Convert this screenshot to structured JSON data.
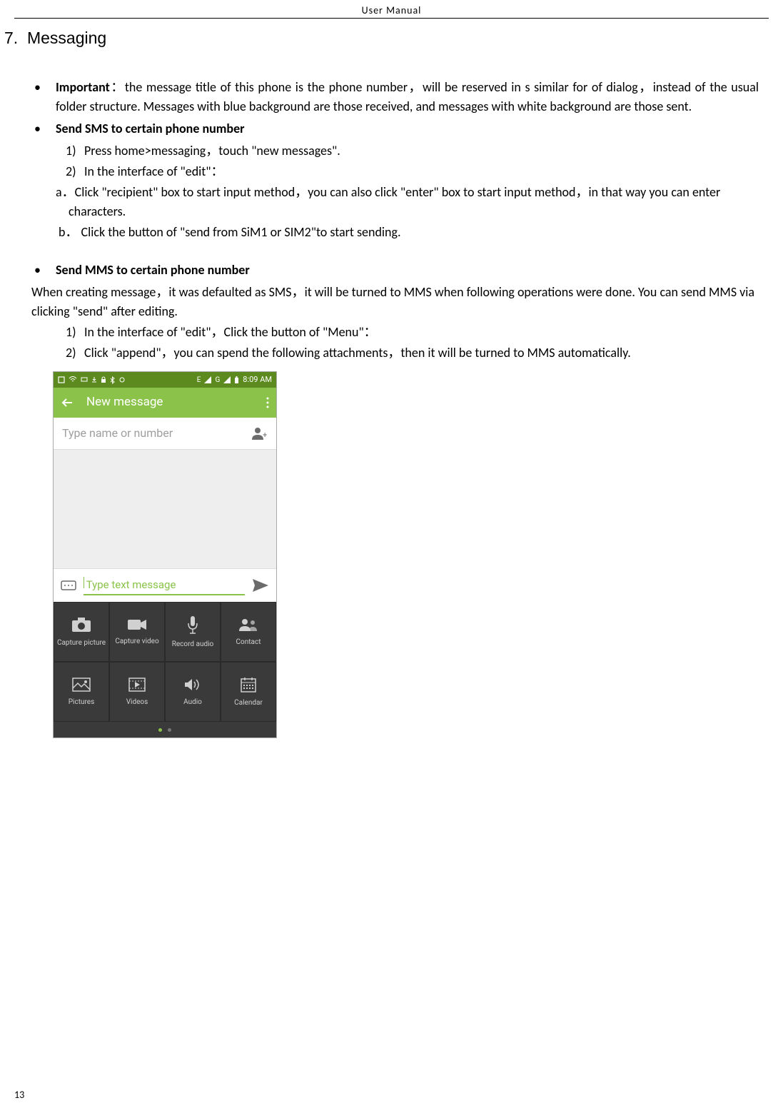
{
  "header": "User    Manual",
  "section": {
    "number": "7.",
    "title": "Messaging"
  },
  "bullets": {
    "important": {
      "label": "Important",
      "text": "：the message title of this phone is the phone number，will be reserved in s similar for of dialog，instead of the usual folder structure. Messages with blue background are those received, and messages with white background are those sent."
    },
    "sms": {
      "label": "Send SMS to certain phone number",
      "steps": [
        {
          "num": "1)",
          "text": "Press home>messaging，touch \"new messages\"."
        },
        {
          "num": "2)",
          "text": "In the interface of \"edit\"："
        }
      ],
      "sub_a": "a．Click \"recipient\" box to start input method，you can also click \"enter\" box to start input method，in that way you can enter characters.",
      "sub_b": "b． Click the button of \"send from SiM1 or SIM2\"to start sending."
    },
    "mms": {
      "label": "Send MMS to certain phone number",
      "para": "When creating message，it was defaulted as SMS，it will be turned to MMS when following operations were done. You can send MMS via clicking \"send\" after editing.",
      "steps": [
        {
          "num": "1)",
          "text": "In the interface of \"edit\"，Click the button of \"Menu\"："
        },
        {
          "num": "2)",
          "text": "Click \"append\"，you can spend the following attachments，then it will be turned to MMS automatically."
        }
      ]
    }
  },
  "phone": {
    "time": "8:09 AM",
    "signal_labels": [
      "E",
      "G"
    ],
    "appbar_title": "New message",
    "recipient_placeholder": "Type name or number",
    "compose_placeholder": "Type text message",
    "attachments": [
      [
        "Capture picture",
        "Capture video",
        "Record audio",
        "Contact"
      ],
      [
        "Pictures",
        "Videos",
        "Audio",
        "Calendar"
      ]
    ]
  },
  "page_number": "13"
}
